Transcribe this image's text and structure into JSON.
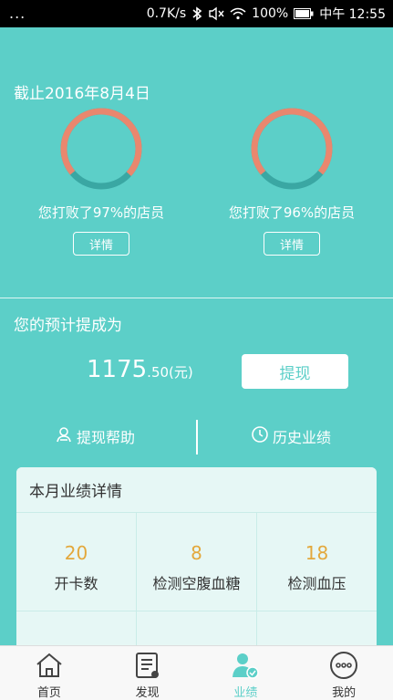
{
  "status_bar": {
    "dots": "...",
    "speed": "0.7K/s",
    "battery": "100%",
    "time": "中午 12:55"
  },
  "stats": {
    "date_label": "截止2016年8月4日",
    "items": [
      {
        "text": "您打败了97%的店员",
        "percent": 97,
        "button": "详情"
      },
      {
        "text": "您打败了96%的店员",
        "percent": 96,
        "button": "详情"
      }
    ],
    "ring_colors": {
      "primary": "#e9876e",
      "secondary": "#3aa7a3"
    }
  },
  "commission": {
    "label": "您的预计提成为",
    "amount_int": "1175",
    "amount_dec": ".50(元)",
    "withdraw_button": "提现"
  },
  "links": {
    "help": "提现帮助",
    "history": "历史业绩"
  },
  "monthly": {
    "title": "本月业绩详情",
    "metrics": [
      {
        "value": "20",
        "label": "开卡数"
      },
      {
        "value": "8",
        "label": "检测空腹血糖"
      },
      {
        "value": "18",
        "label": "检测血压"
      }
    ]
  },
  "nav": {
    "items": [
      {
        "label": "首页",
        "icon": "home-icon"
      },
      {
        "label": "发现",
        "icon": "discover-icon"
      },
      {
        "label": "业绩",
        "icon": "performance-icon"
      },
      {
        "label": "我的",
        "icon": "more-icon"
      }
    ],
    "active_index": 2
  },
  "colors": {
    "accent": "#5ccfc8",
    "number": "#e3a83c"
  }
}
